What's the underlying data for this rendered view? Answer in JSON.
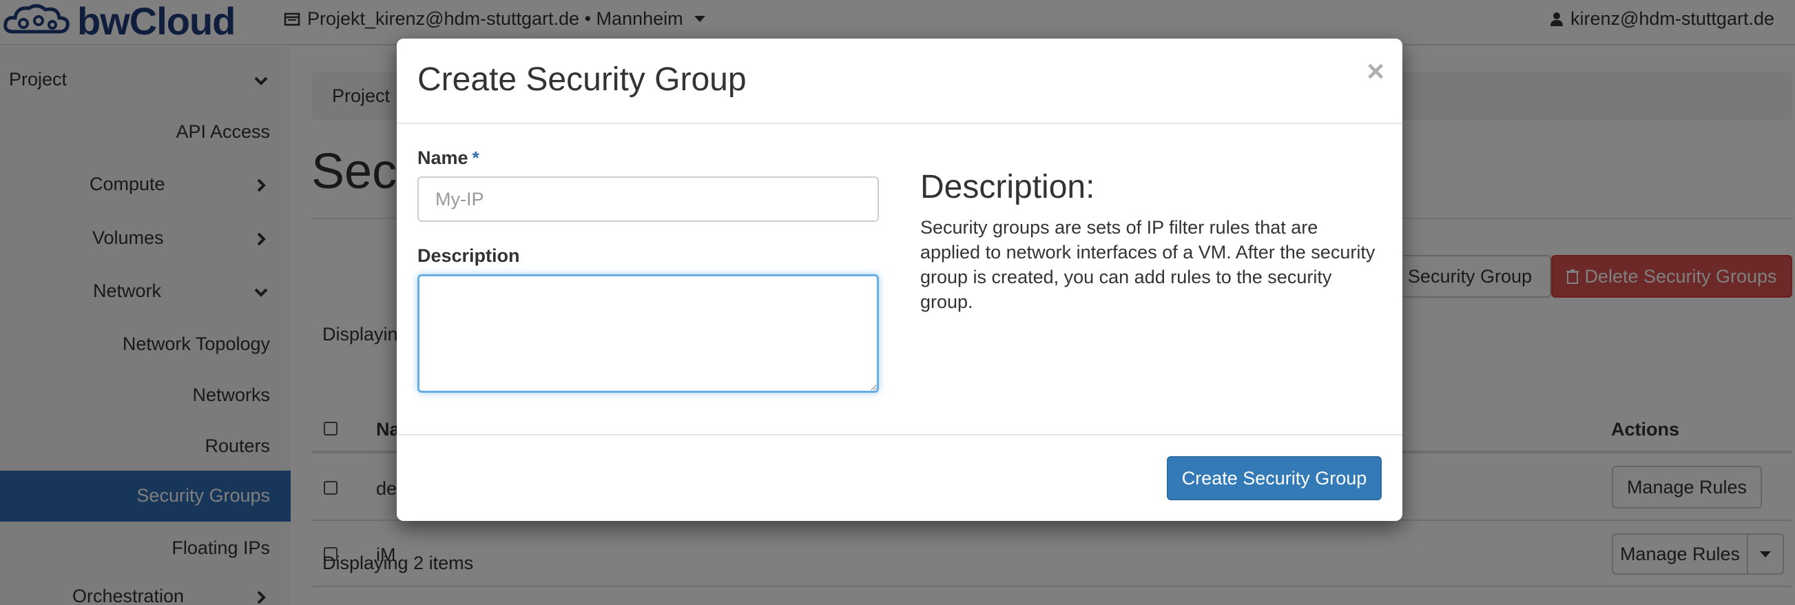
{
  "navbar": {
    "brand": "bwCloud",
    "project_selector": "Projekt_kirenz@hdm-stuttgart.de • Mannheim",
    "user": "kirenz@hdm-stuttgart.de"
  },
  "sidebar": {
    "items": [
      {
        "label": "Project",
        "icon": "chevron-down-icon"
      },
      {
        "label": "API Access"
      },
      {
        "label": "Compute",
        "icon": "chevron-right-icon"
      },
      {
        "label": "Volumes",
        "icon": "chevron-right-icon"
      },
      {
        "label": "Network",
        "icon": "chevron-down-icon"
      },
      {
        "label": "Network Topology"
      },
      {
        "label": "Networks"
      },
      {
        "label": "Routers"
      },
      {
        "label": "Security Groups",
        "active": true
      },
      {
        "label": "Floating IPs"
      },
      {
        "label": "Orchestration",
        "icon": "chevron-right-icon"
      }
    ]
  },
  "main": {
    "breadcrumb": "Project",
    "page_title_partial": "Secu",
    "create_button_partial": "Security Group",
    "delete_button": "Delete Security Groups",
    "displaying_top_partial": "Displaying",
    "table": {
      "header_name_partial": "Na",
      "header_actions": "Actions",
      "rows": [
        {
          "name_partial": "de",
          "action": "Manage Rules"
        },
        {
          "name_partial": "iM",
          "action": "Manage Rules"
        }
      ]
    },
    "displaying_bottom": "Displaying 2 items"
  },
  "modal": {
    "title": "Create Security Group",
    "close": "×",
    "name_label": "Name",
    "required_marker": "*",
    "name_placeholder": "My-IP",
    "description_label": "Description",
    "help_heading": "Description:",
    "help_text": "Security groups are sets of IP filter rules that are applied to network interfaces of a VM. After the security group is created, you can add rules to the security group.",
    "submit": "Create Security Group"
  },
  "colors": {
    "brand": "#1f3d7a",
    "active_sidebar": "#2f6db5",
    "primary_button": "#337ab7",
    "danger_button": "#d9534f"
  }
}
